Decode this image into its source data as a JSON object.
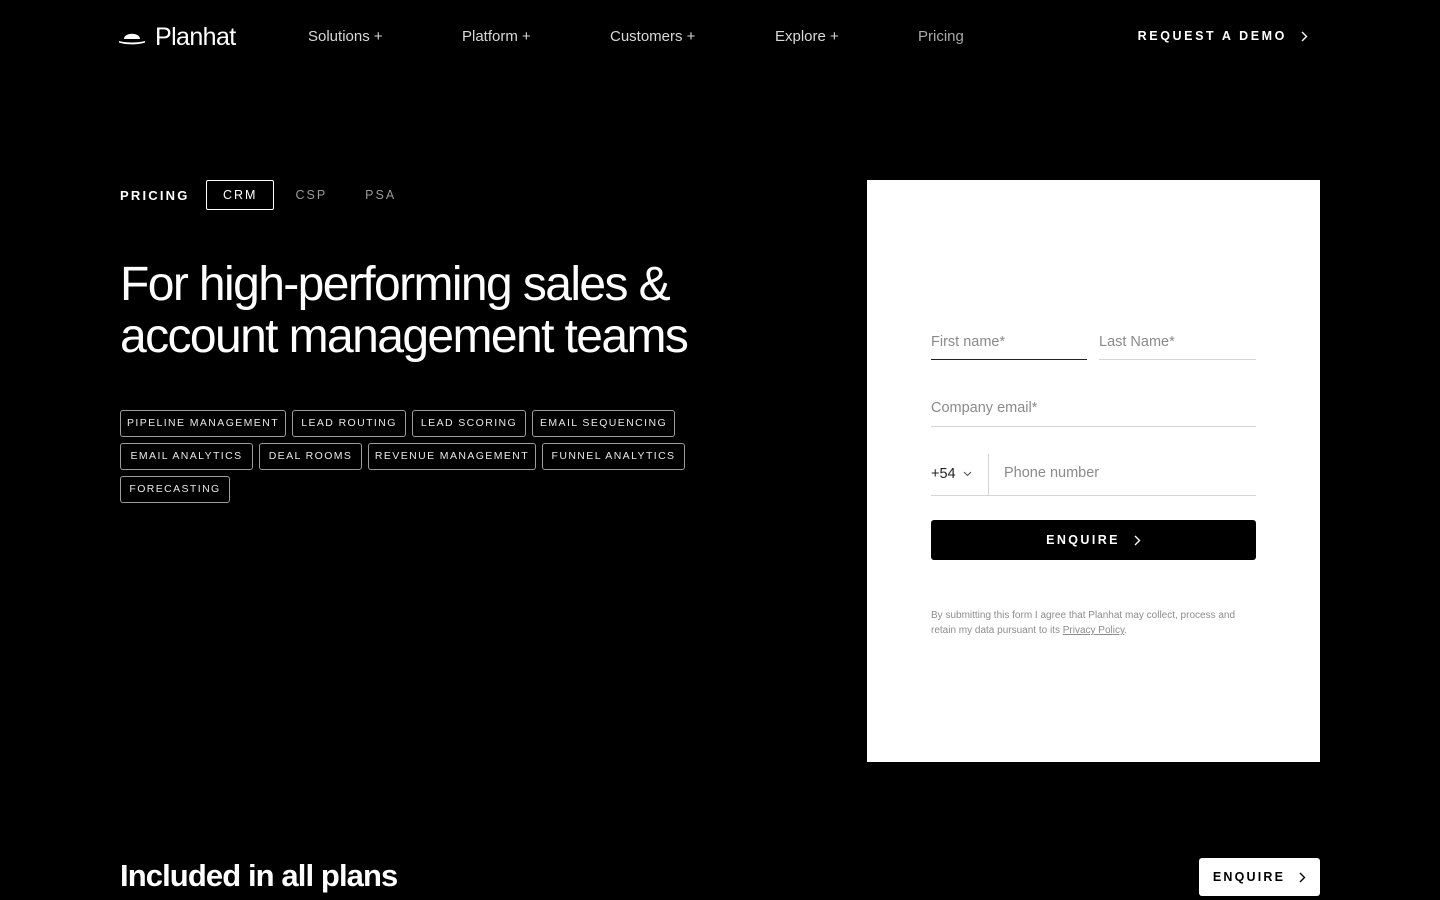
{
  "brand": {
    "name": "Planhat",
    "logo_icon": "hat-icon"
  },
  "nav": {
    "links": [
      "Solutions +",
      "Platform +",
      "Customers +",
      "Explore +",
      "Pricing"
    ],
    "cta_label": "REQUEST A DEMO"
  },
  "tabs": {
    "section_label": "PRICING",
    "items": [
      "CRM",
      "CSP",
      "PSA"
    ],
    "active": "CRM"
  },
  "headline": "For high-performing sales & account management teams",
  "features": [
    "PIPELINE MANAGEMENT",
    "LEAD ROUTING",
    "LEAD SCORING",
    "EMAIL SEQUENCING",
    "EMAIL ANALYTICS",
    "DEAL ROOMS",
    "REVENUE MANAGEMENT",
    "FUNNEL ANALYTICS",
    "FORECASTING"
  ],
  "form": {
    "first_name_placeholder": "First name*",
    "last_name_placeholder": "Last Name*",
    "email_placeholder": "Company email*",
    "country_code": "+54",
    "phone_placeholder": "Phone number",
    "submit_label": "ENQUIRE",
    "legal_text": "By submitting this form I agree that Planhat may collect, process and retain my data pursuant to its",
    "privacy_link": "Privacy Policy",
    "legal_suffix": "."
  },
  "included_title": "Included in all plans",
  "bottom_cta": "ENQUIRE"
}
